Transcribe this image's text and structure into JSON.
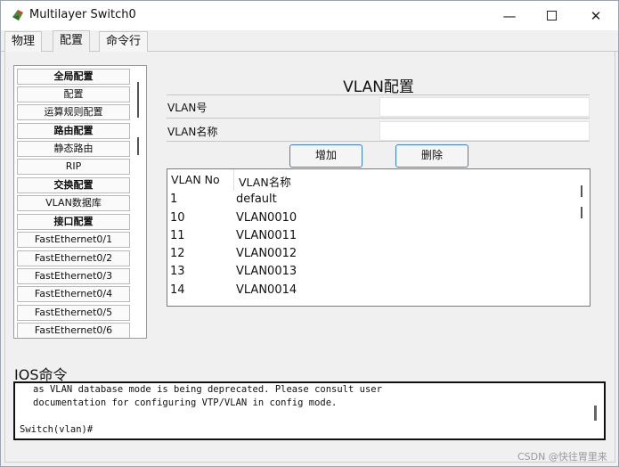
{
  "window": {
    "title": "Multilayer Switch0",
    "controls": {
      "minimize": "—",
      "close": "✕"
    }
  },
  "tabs": [
    {
      "label": "物理"
    },
    {
      "label": "配置"
    },
    {
      "label": "命令行"
    }
  ],
  "menu": {
    "items": [
      {
        "label": "全局配置",
        "bold": true
      },
      {
        "label": "配置",
        "bold": false
      },
      {
        "label": "运算规则配置",
        "bold": false
      },
      {
        "label": "路由配置",
        "bold": true
      },
      {
        "label": "静态路由",
        "bold": false
      },
      {
        "label": "RIP",
        "bold": false
      },
      {
        "label": "交换配置",
        "bold": true
      },
      {
        "label": "VLAN数据库",
        "bold": false
      },
      {
        "label": "接口配置",
        "bold": true
      },
      {
        "label": "FastEthernet0/1",
        "bold": false
      },
      {
        "label": "FastEthernet0/2",
        "bold": false
      },
      {
        "label": "FastEthernet0/3",
        "bold": false
      },
      {
        "label": "FastEthernet0/4",
        "bold": false
      },
      {
        "label": "FastEthernet0/5",
        "bold": false
      },
      {
        "label": "FastEthernet0/6",
        "bold": false
      }
    ]
  },
  "vlan": {
    "title": "VLAN配置",
    "number_label": "VLAN号",
    "number_value": "",
    "name_label": "VLAN名称",
    "name_value": "",
    "add_label": "增加",
    "delete_label": "删除",
    "table": {
      "headers": [
        "VLAN No",
        "VLAN名称"
      ],
      "rows": [
        [
          "1",
          "default"
        ],
        [
          "10",
          "VLAN0010"
        ],
        [
          "11",
          "VLAN0011"
        ],
        [
          "12",
          "VLAN0012"
        ],
        [
          "13",
          "VLAN0013"
        ],
        [
          "14",
          "VLAN0014"
        ]
      ]
    }
  },
  "ios": {
    "label": "IOS命令",
    "lines": [
      "as VLAN database mode is being deprecated. Please consult user",
      "documentation for configuring VTP/VLAN in config mode."
    ],
    "prompt": "Switch(vlan)#"
  },
  "watermark": "CSDN @快往胃里来",
  "colors": {
    "accent": "#3b7fd6",
    "panel": "#f0f0f0"
  }
}
